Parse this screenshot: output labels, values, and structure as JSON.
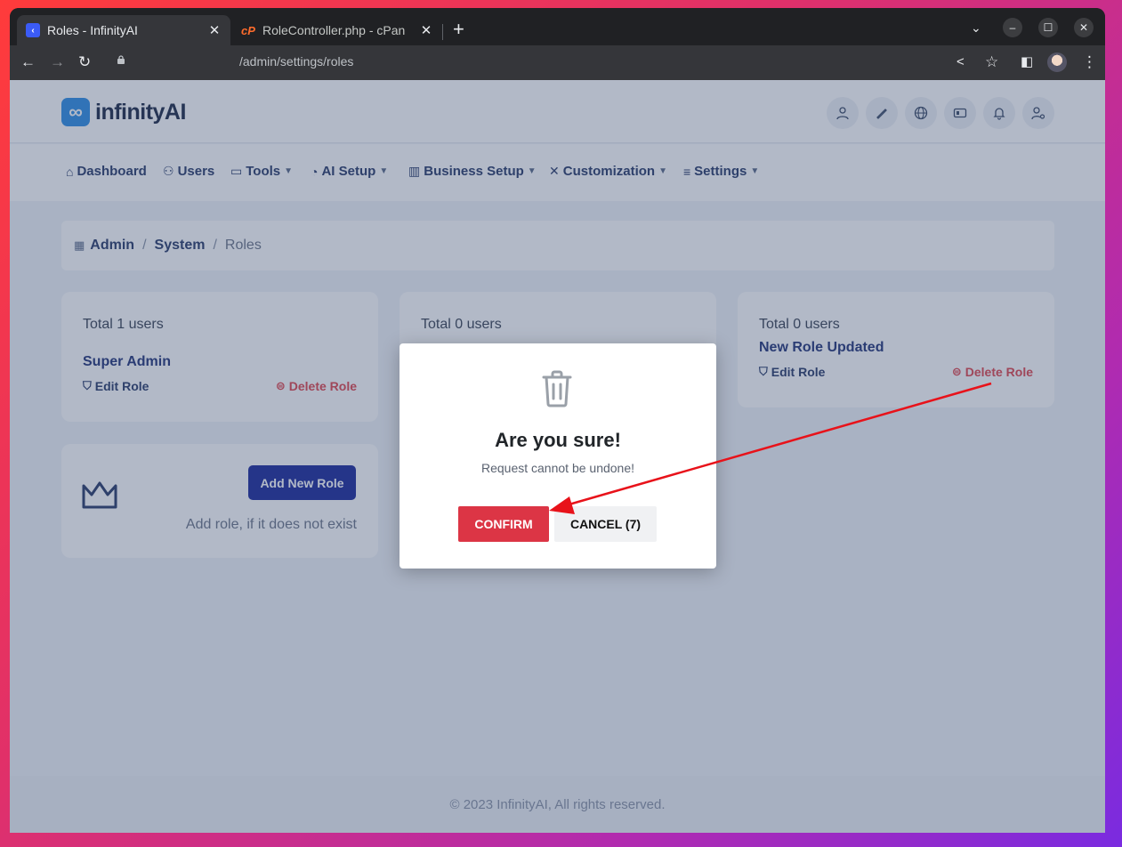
{
  "browser": {
    "tabs": [
      {
        "title": "Roles - InfinityAI",
        "active": true
      },
      {
        "title": "RoleController.php - cPan",
        "active": false
      }
    ],
    "url": "/admin/settings/roles",
    "favicon_cpanel": "cP"
  },
  "app": {
    "logo_mark": "∞",
    "logo_text": "infinityAI",
    "header_icons": [
      "user-icon",
      "paint-brush-icon",
      "globe-icon",
      "id-card-icon",
      "bell-icon",
      "user-settings-icon"
    ]
  },
  "nav": [
    {
      "label": "Dashboard",
      "icon": "home-icon",
      "dropdown": false
    },
    {
      "label": "Users",
      "icon": "users-icon",
      "dropdown": false
    },
    {
      "label": "Tools",
      "icon": "briefcase-icon",
      "dropdown": true
    },
    {
      "label": "AI Setup",
      "icon": "gauge-icon",
      "dropdown": true
    },
    {
      "label": "Business Setup",
      "icon": "building-icon",
      "dropdown": true
    },
    {
      "label": "Customization",
      "icon": "tools-icon",
      "dropdown": true
    },
    {
      "label": "Settings",
      "icon": "sliders-icon",
      "dropdown": true
    }
  ],
  "breadcrumb": {
    "items": [
      "Admin",
      "System"
    ],
    "current": "Roles",
    "separator": "/"
  },
  "roles": [
    {
      "total": "Total 1 users",
      "name": "Super Admin",
      "edit": "Edit Role",
      "delete": "Delete Role"
    },
    {
      "total": "Total 0 users",
      "name": "",
      "edit": "",
      "delete": ""
    },
    {
      "total": "Total 0 users",
      "name": "New Role Updated",
      "edit": "Edit Role",
      "delete": "Delete Role"
    }
  ],
  "add_role": {
    "button": "Add New Role",
    "hint": "Add role, if it does not exist"
  },
  "footer": "© 2023 InfinityAI, All rights reserved.",
  "modal": {
    "icon": "trash-icon",
    "title": "Are you sure!",
    "subtitle": "Request cannot be undone!",
    "confirm": "CONFIRM",
    "cancel": "CANCEL (7)"
  },
  "colors": {
    "confirm": "#dc3545",
    "primary": "#1c2a9c",
    "danger": "#e0474f",
    "annotation_arrow": "#e8121a"
  }
}
